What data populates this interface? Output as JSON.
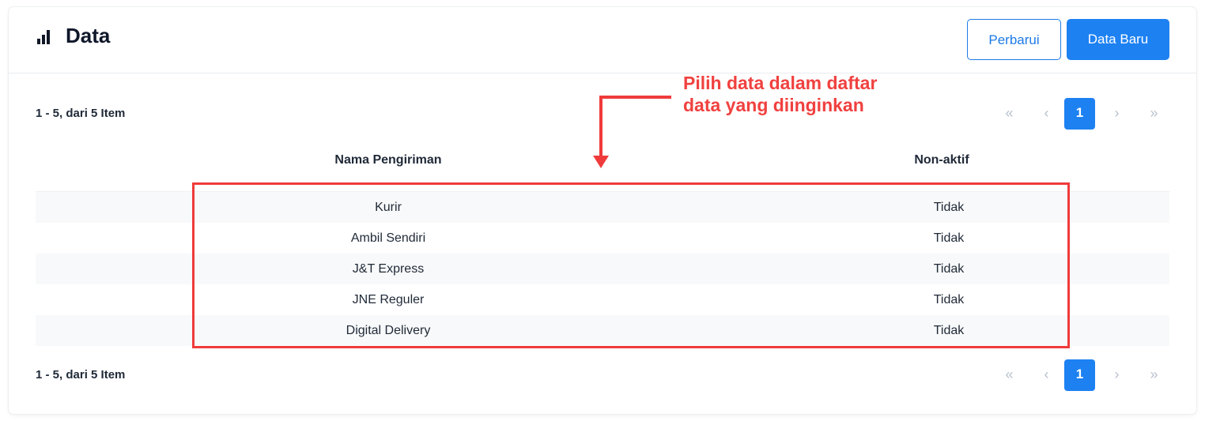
{
  "header": {
    "title": "Data",
    "buttons": {
      "refresh_label": "Perbarui",
      "new_label": "Data Baru"
    }
  },
  "pagination": {
    "range_text_top": "1 - 5, dari 5 Item",
    "range_text_bottom": "1 - 5, dari 5 Item",
    "first": "«",
    "prev": "‹",
    "current_page": "1",
    "next": "›",
    "last": "»"
  },
  "table": {
    "columns": [
      "Nama Pengiriman",
      "Non-aktif"
    ],
    "rows": [
      {
        "name": "Kurir",
        "inactive": "Tidak"
      },
      {
        "name": "Ambil Sendiri",
        "inactive": "Tidak"
      },
      {
        "name": "J&T Express",
        "inactive": "Tidak"
      },
      {
        "name": "JNE Reguler",
        "inactive": "Tidak"
      },
      {
        "name": "Digital Delivery",
        "inactive": "Tidak"
      }
    ]
  },
  "annotation": {
    "line1": "Pilih data dalam daftar",
    "line2": "data yang diinginkan",
    "color": "#f0413f"
  },
  "icons": {
    "title_icon": "bar-chart-icon"
  },
  "colors": {
    "primary": "#1d81f2",
    "highlight": "#ef3b3b"
  }
}
